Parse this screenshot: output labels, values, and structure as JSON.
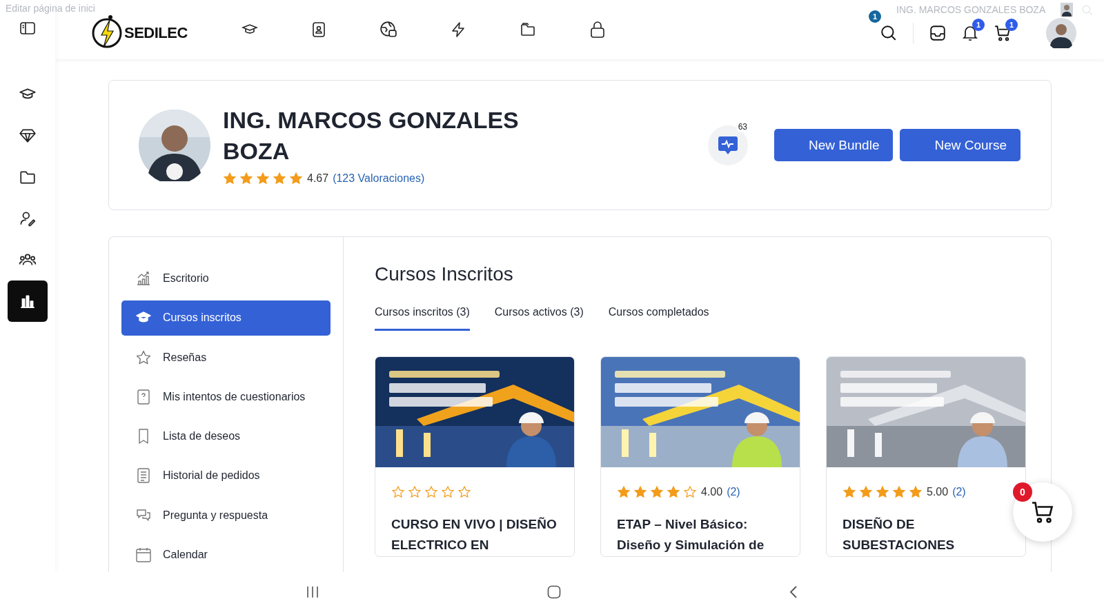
{
  "overlay": {
    "page_hint": "Editar página de inici",
    "user_name": "ING. MARCOS GONZALES BOZA",
    "badge": "1"
  },
  "brand": {
    "name": "SEDILEC"
  },
  "header_badges": {
    "notifications": "1",
    "cart": "1"
  },
  "rail": [
    {
      "selected": false
    },
    {
      "selected": false
    },
    {
      "selected": false
    },
    {
      "selected": false
    },
    {
      "selected": false
    },
    {
      "selected": true
    }
  ],
  "profile": {
    "name": "ING. MARCOS GONZALES BOZA",
    "stars": 5,
    "rating": "4.67",
    "reviews": "(123 Valoraciones)",
    "pulse_badge": "63",
    "buttons": [
      "New Bundle",
      "New Course"
    ]
  },
  "menu": [
    {
      "label": "Escritorio",
      "selected": false
    },
    {
      "label": "Cursos inscritos",
      "selected": true
    },
    {
      "label": "Reseñas",
      "selected": false
    },
    {
      "label": "Mis intentos de cuestionarios",
      "selected": false
    },
    {
      "label": "Lista de deseos",
      "selected": false
    },
    {
      "label": "Historial de pedidos",
      "selected": false
    },
    {
      "label": "Pregunta y respuesta",
      "selected": false
    },
    {
      "label": "Calendar",
      "selected": false
    }
  ],
  "content": {
    "title": "Cursos Inscritos",
    "tabs": [
      {
        "label": "Cursos inscritos (3)",
        "selected": true
      },
      {
        "label": "Cursos activos (3)",
        "selected": false
      },
      {
        "label": "Cursos completados",
        "selected": false
      }
    ],
    "courses": [
      {
        "kind": "picture",
        "stars": 0,
        "title": "CURSO EN VIVO | DISEÑO ELECTRICO EN"
      },
      {
        "kind": "picture",
        "stars": 4,
        "rating": "4.00",
        "count": "(2)",
        "title": "ETAP – Nivel Básico: Diseño y Simulación de"
      },
      {
        "kind": "picture",
        "stars": 5,
        "rating": "5.00",
        "count": "(2)",
        "title": "DISEÑO DE SUBESTACIONES"
      }
    ]
  },
  "floating_cart": {
    "badge": "0"
  }
}
